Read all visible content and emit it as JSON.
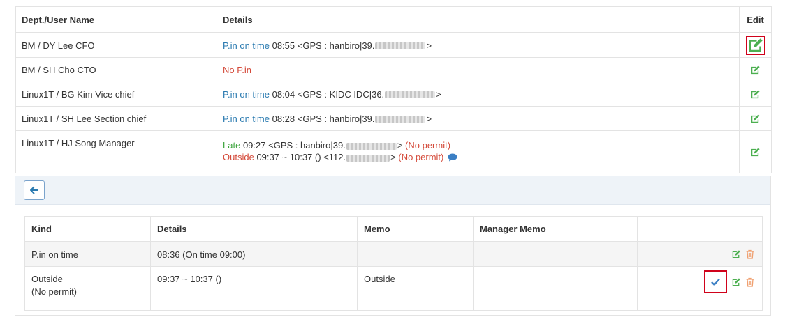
{
  "top_table": {
    "headers": {
      "name": "Dept./User Name",
      "details": "Details",
      "edit": "Edit"
    },
    "rows": [
      {
        "name": "BM / DY Lee CFO",
        "status": "P.in on time",
        "time": "08:55",
        "gps_prefix": "<GPS : hanbiro|39.",
        "gps_suffix": ">"
      },
      {
        "name": "BM / SH Cho CTO",
        "status": "No P.in"
      },
      {
        "name": "Linux1T / BG Kim Vice chief",
        "status": "P.in on time",
        "time": "08:04",
        "gps_prefix": "<GPS : KIDC IDC|36.",
        "gps_suffix": ">"
      },
      {
        "name": "Linux1T / SH Lee Section chief",
        "status": "P.in on time",
        "time": "08:28",
        "gps_prefix": "<GPS : hanbiro|39.",
        "gps_suffix": ">"
      },
      {
        "name": "Linux1T / HJ Song Manager",
        "line1_status": "Late",
        "line1_time": "09:27",
        "line1_gps_prefix": "<GPS : hanbiro|39.",
        "line1_gps_suffix": ">",
        "line1_flag": "(No permit)",
        "line2_status": "Outside",
        "line2_time": "09:37 ~ 10:37 () <112.",
        "line2_suffix": ">",
        "line2_flag": "(No permit)"
      }
    ]
  },
  "bottom_table": {
    "headers": {
      "kind": "Kind",
      "details": "Details",
      "memo": "Memo",
      "manager_memo": "Manager Memo",
      "actions": ""
    },
    "rows": [
      {
        "kind": "P.in on time",
        "kind2": "",
        "details": "08:36 (On time 09:00)",
        "memo": "",
        "manager_memo": ""
      },
      {
        "kind": "Outside",
        "kind2": "(No permit)",
        "details": "09:37 ~ 10:37 ()",
        "memo": "Outside",
        "manager_memo": ""
      }
    ]
  },
  "colors": {
    "blue": "#2a7ab0",
    "red": "#d44a3a",
    "green": "#3aa33a",
    "highlight": "#d0021b",
    "edit_icon": "#4caf50",
    "delete_icon": "#f0a070",
    "check_icon": "#3b7fc4"
  },
  "icons": {
    "edit": "edit-icon",
    "delete": "trash-icon",
    "approve": "check-icon",
    "back": "arrow-left-icon",
    "comment": "chat-bubble-icon"
  }
}
